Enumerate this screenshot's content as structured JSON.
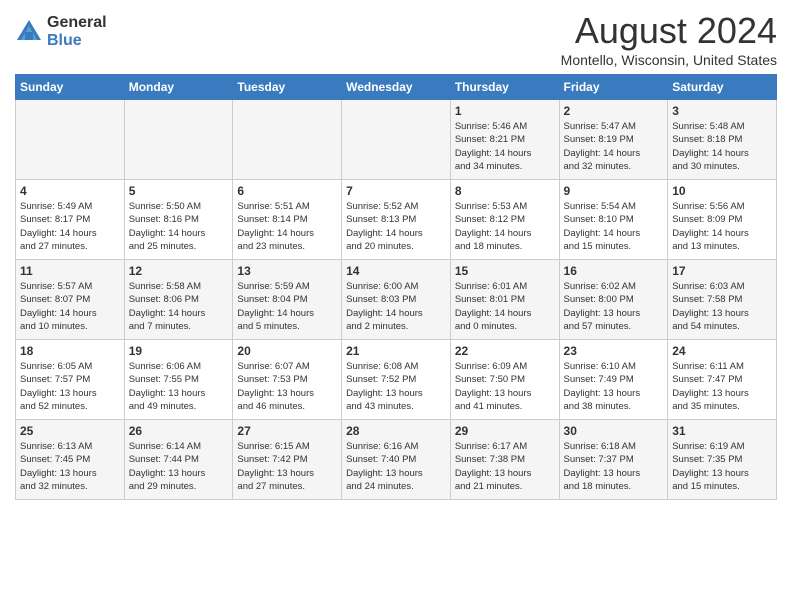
{
  "logo": {
    "general": "General",
    "blue": "Blue"
  },
  "title": "August 2024",
  "location": "Montello, Wisconsin, United States",
  "weekdays": [
    "Sunday",
    "Monday",
    "Tuesday",
    "Wednesday",
    "Thursday",
    "Friday",
    "Saturday"
  ],
  "weeks": [
    [
      {
        "day": "",
        "info": ""
      },
      {
        "day": "",
        "info": ""
      },
      {
        "day": "",
        "info": ""
      },
      {
        "day": "",
        "info": ""
      },
      {
        "day": "1",
        "info": "Sunrise: 5:46 AM\nSunset: 8:21 PM\nDaylight: 14 hours\nand 34 minutes."
      },
      {
        "day": "2",
        "info": "Sunrise: 5:47 AM\nSunset: 8:19 PM\nDaylight: 14 hours\nand 32 minutes."
      },
      {
        "day": "3",
        "info": "Sunrise: 5:48 AM\nSunset: 8:18 PM\nDaylight: 14 hours\nand 30 minutes."
      }
    ],
    [
      {
        "day": "4",
        "info": "Sunrise: 5:49 AM\nSunset: 8:17 PM\nDaylight: 14 hours\nand 27 minutes."
      },
      {
        "day": "5",
        "info": "Sunrise: 5:50 AM\nSunset: 8:16 PM\nDaylight: 14 hours\nand 25 minutes."
      },
      {
        "day": "6",
        "info": "Sunrise: 5:51 AM\nSunset: 8:14 PM\nDaylight: 14 hours\nand 23 minutes."
      },
      {
        "day": "7",
        "info": "Sunrise: 5:52 AM\nSunset: 8:13 PM\nDaylight: 14 hours\nand 20 minutes."
      },
      {
        "day": "8",
        "info": "Sunrise: 5:53 AM\nSunset: 8:12 PM\nDaylight: 14 hours\nand 18 minutes."
      },
      {
        "day": "9",
        "info": "Sunrise: 5:54 AM\nSunset: 8:10 PM\nDaylight: 14 hours\nand 15 minutes."
      },
      {
        "day": "10",
        "info": "Sunrise: 5:56 AM\nSunset: 8:09 PM\nDaylight: 14 hours\nand 13 minutes."
      }
    ],
    [
      {
        "day": "11",
        "info": "Sunrise: 5:57 AM\nSunset: 8:07 PM\nDaylight: 14 hours\nand 10 minutes."
      },
      {
        "day": "12",
        "info": "Sunrise: 5:58 AM\nSunset: 8:06 PM\nDaylight: 14 hours\nand 7 minutes."
      },
      {
        "day": "13",
        "info": "Sunrise: 5:59 AM\nSunset: 8:04 PM\nDaylight: 14 hours\nand 5 minutes."
      },
      {
        "day": "14",
        "info": "Sunrise: 6:00 AM\nSunset: 8:03 PM\nDaylight: 14 hours\nand 2 minutes."
      },
      {
        "day": "15",
        "info": "Sunrise: 6:01 AM\nSunset: 8:01 PM\nDaylight: 14 hours\nand 0 minutes."
      },
      {
        "day": "16",
        "info": "Sunrise: 6:02 AM\nSunset: 8:00 PM\nDaylight: 13 hours\nand 57 minutes."
      },
      {
        "day": "17",
        "info": "Sunrise: 6:03 AM\nSunset: 7:58 PM\nDaylight: 13 hours\nand 54 minutes."
      }
    ],
    [
      {
        "day": "18",
        "info": "Sunrise: 6:05 AM\nSunset: 7:57 PM\nDaylight: 13 hours\nand 52 minutes."
      },
      {
        "day": "19",
        "info": "Sunrise: 6:06 AM\nSunset: 7:55 PM\nDaylight: 13 hours\nand 49 minutes."
      },
      {
        "day": "20",
        "info": "Sunrise: 6:07 AM\nSunset: 7:53 PM\nDaylight: 13 hours\nand 46 minutes."
      },
      {
        "day": "21",
        "info": "Sunrise: 6:08 AM\nSunset: 7:52 PM\nDaylight: 13 hours\nand 43 minutes."
      },
      {
        "day": "22",
        "info": "Sunrise: 6:09 AM\nSunset: 7:50 PM\nDaylight: 13 hours\nand 41 minutes."
      },
      {
        "day": "23",
        "info": "Sunrise: 6:10 AM\nSunset: 7:49 PM\nDaylight: 13 hours\nand 38 minutes."
      },
      {
        "day": "24",
        "info": "Sunrise: 6:11 AM\nSunset: 7:47 PM\nDaylight: 13 hours\nand 35 minutes."
      }
    ],
    [
      {
        "day": "25",
        "info": "Sunrise: 6:13 AM\nSunset: 7:45 PM\nDaylight: 13 hours\nand 32 minutes."
      },
      {
        "day": "26",
        "info": "Sunrise: 6:14 AM\nSunset: 7:44 PM\nDaylight: 13 hours\nand 29 minutes."
      },
      {
        "day": "27",
        "info": "Sunrise: 6:15 AM\nSunset: 7:42 PM\nDaylight: 13 hours\nand 27 minutes."
      },
      {
        "day": "28",
        "info": "Sunrise: 6:16 AM\nSunset: 7:40 PM\nDaylight: 13 hours\nand 24 minutes."
      },
      {
        "day": "29",
        "info": "Sunrise: 6:17 AM\nSunset: 7:38 PM\nDaylight: 13 hours\nand 21 minutes."
      },
      {
        "day": "30",
        "info": "Sunrise: 6:18 AM\nSunset: 7:37 PM\nDaylight: 13 hours\nand 18 minutes."
      },
      {
        "day": "31",
        "info": "Sunrise: 6:19 AM\nSunset: 7:35 PM\nDaylight: 13 hours\nand 15 minutes."
      }
    ]
  ]
}
